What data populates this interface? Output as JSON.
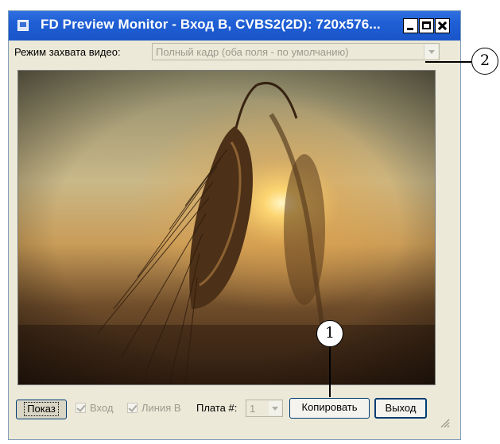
{
  "window": {
    "title": "FD Preview Monitor - Вход B, CVBS2(2D): 720x576...",
    "controls": {
      "minimize": "_",
      "maximize": "□",
      "close": "×"
    }
  },
  "capture_mode": {
    "label": "Режим захвата видео:",
    "value": "Полный кадр (оба поля - по умолчанию)"
  },
  "preview": {
    "image": "wheat-ear-at-sunset"
  },
  "bottom_bar": {
    "show_label": "Показ",
    "input_label": "Вход",
    "line_label": "Линия B",
    "board_label": "Плата #:",
    "board_value": "1",
    "copy_label": "Копировать",
    "exit_label": "Выход"
  },
  "callouts": {
    "one": "1",
    "two": "2"
  }
}
